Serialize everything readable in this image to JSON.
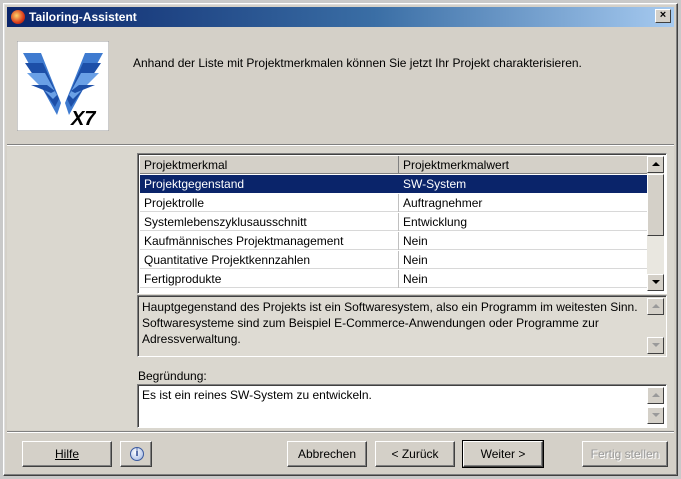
{
  "window": {
    "title": "Tailoring-Assistent",
    "close_glyph": "×"
  },
  "header": {
    "logo_text": "X7",
    "intro": "Anhand der Liste mit Projektmerkmalen können Sie jetzt Ihr Projekt charakterisieren."
  },
  "table": {
    "columns": [
      "Projektmerkmal",
      "Projektmerkmalwert"
    ],
    "rows": [
      {
        "name": "Projektgegenstand",
        "value": "SW-System"
      },
      {
        "name": "Projektrolle",
        "value": "Auftragnehmer"
      },
      {
        "name": "Systemlebenszyklusausschnitt",
        "value": "Entwicklung"
      },
      {
        "name": "Kaufmännisches Projektmanagement",
        "value": "Nein"
      },
      {
        "name": "Quantitative Projektkennzahlen",
        "value": "Nein"
      },
      {
        "name": "Fertigprodukte",
        "value": "Nein"
      }
    ]
  },
  "description": "Hauptgegenstand des Projekts ist ein Softwaresystem, also ein Programm im weitesten Sinn. Softwaresysteme sind zum Beispiel E-Commerce-Anwendungen oder Programme zur Adressverwaltung.",
  "reason": {
    "label": "Begründung:",
    "value": "Es ist ein reines SW-System zu entwickeln."
  },
  "buttons": {
    "help": "Hilfe",
    "info": "i",
    "cancel": "Abbrechen",
    "back": "< Zurück",
    "next": "Weiter >",
    "finish": "Fertig stellen"
  },
  "icons": {
    "app": "app-icon",
    "close": "close-icon",
    "info": "info-icon",
    "scroll_up": "scroll-up-icon",
    "scroll_down": "scroll-down-icon"
  },
  "colors": {
    "title_gradient_start": "#0a246a",
    "title_gradient_end": "#a6caf0",
    "selection": "#0a246a",
    "logo_blue": "#1d4fa8"
  }
}
